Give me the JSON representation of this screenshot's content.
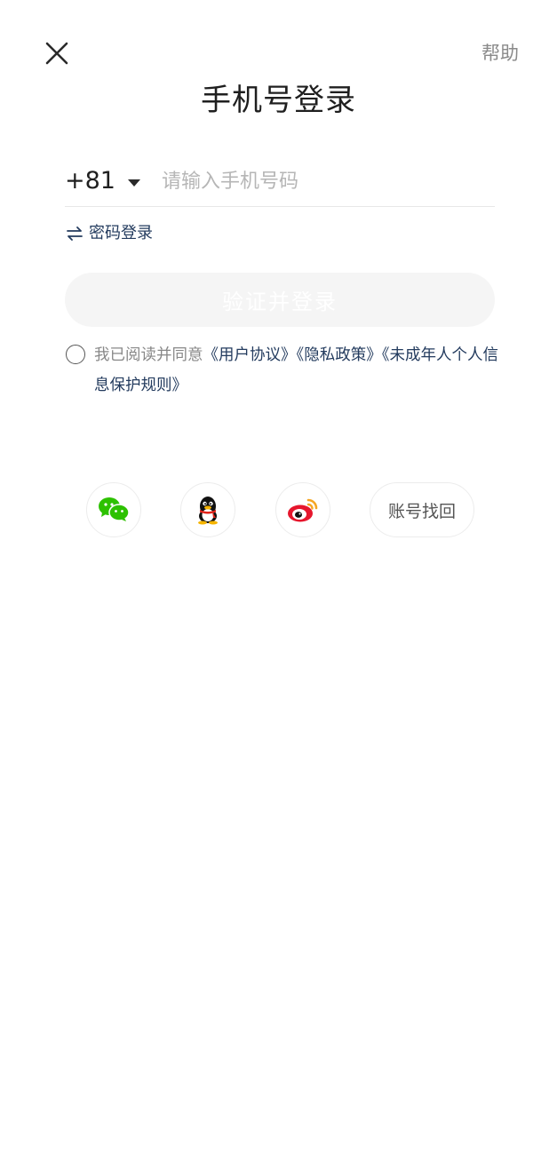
{
  "header": {
    "close_icon": "close-icon",
    "help_label": "帮助",
    "title": "手机号登录"
  },
  "phone": {
    "country_code": "+81",
    "placeholder": "请输入手机号码",
    "value": ""
  },
  "switch_login": {
    "icon": "swap-arrows-icon",
    "label": "密码登录"
  },
  "submit": {
    "label": "验证并登录",
    "bg_color": "#f5f5f5",
    "text_color": "#ffffff"
  },
  "agreement": {
    "prefix": "我已阅读并同意",
    "user_agreement": "《用户协议》",
    "privacy_policy": "《隐私政策》",
    "minor_rules": "《未成年人个人信息保护规则》",
    "checked": false,
    "link_color": "#233b5e"
  },
  "social": {
    "items": [
      {
        "name": "wechat",
        "icon": "wechat-icon",
        "color": "#2dc100"
      },
      {
        "name": "qq",
        "icon": "qq-penguin-icon",
        "color": "#000000"
      },
      {
        "name": "weibo",
        "icon": "weibo-icon",
        "color": "#e6162d"
      }
    ],
    "recover_label": "账号找回"
  }
}
